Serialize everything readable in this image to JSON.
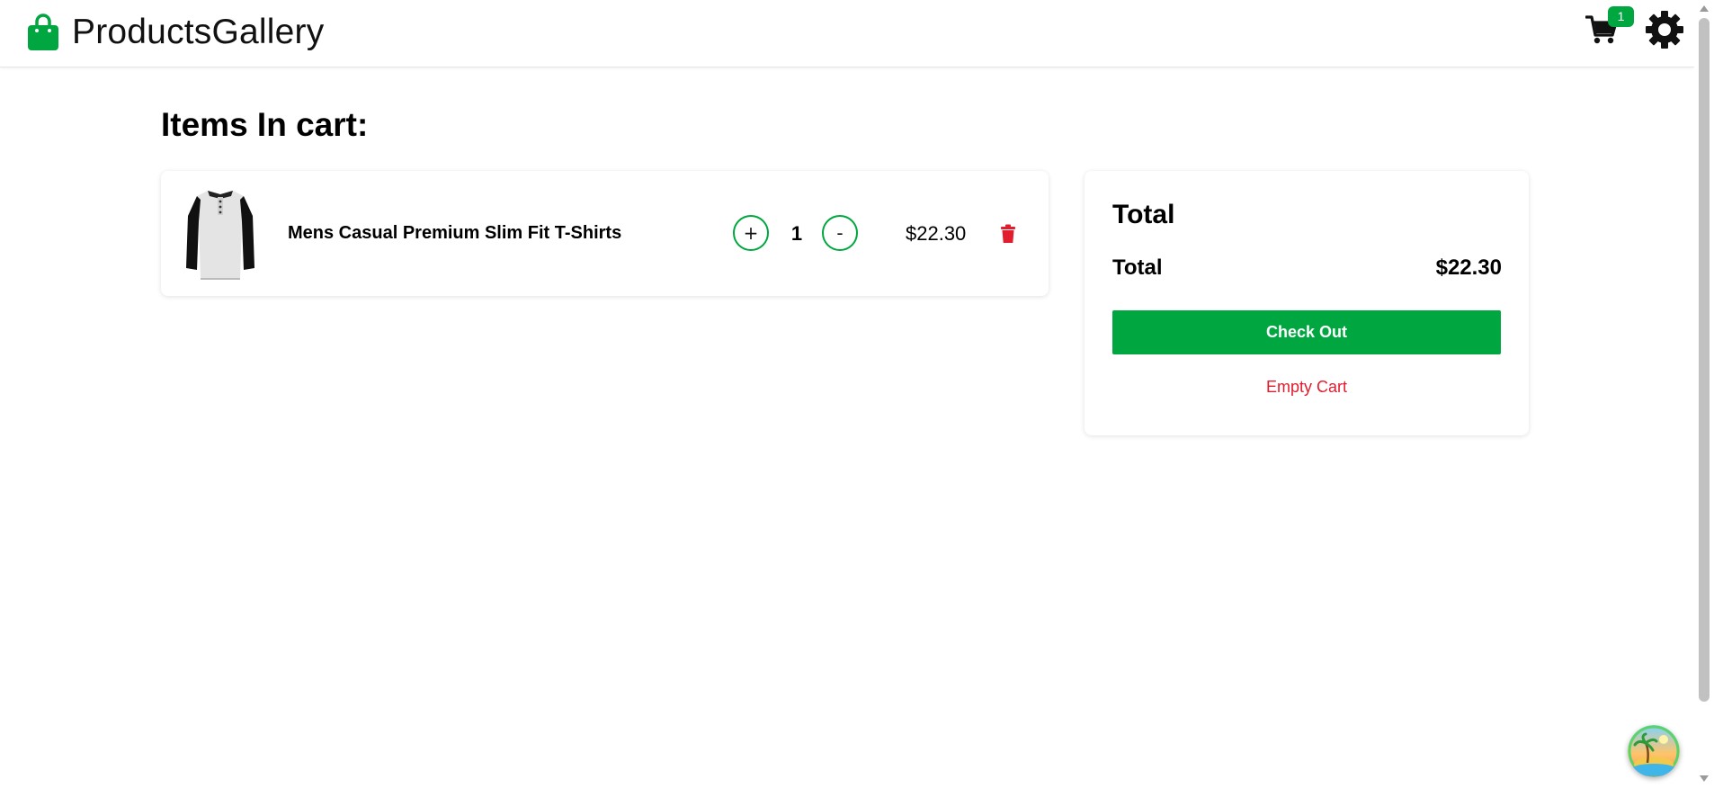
{
  "header": {
    "brand_name": "ProductsGallery",
    "brand_icon": "shopping-bag-icon",
    "cart_icon": "cart-icon",
    "cart_count": "1",
    "settings_icon": "gear-icon"
  },
  "main": {
    "title": "Items In cart:"
  },
  "cart_items": [
    {
      "name": "Mens Casual Premium Slim Fit T-Shirts",
      "image": "tshirt-image",
      "quantity": "1",
      "plus_label": "+",
      "minus_label": "-",
      "price": "$22.30",
      "delete_icon": "trash-icon"
    }
  ],
  "summary": {
    "heading": "Total",
    "total_label": "Total",
    "total_value": "$22.30",
    "checkout_label": "Check Out",
    "empty_cart_label": "Empty Cart"
  },
  "colors": {
    "accent_green": "#00a63f",
    "danger_red": "#e11d2e",
    "text": "#111111"
  },
  "floating_widget": {
    "icon": "island-avatar-icon"
  }
}
